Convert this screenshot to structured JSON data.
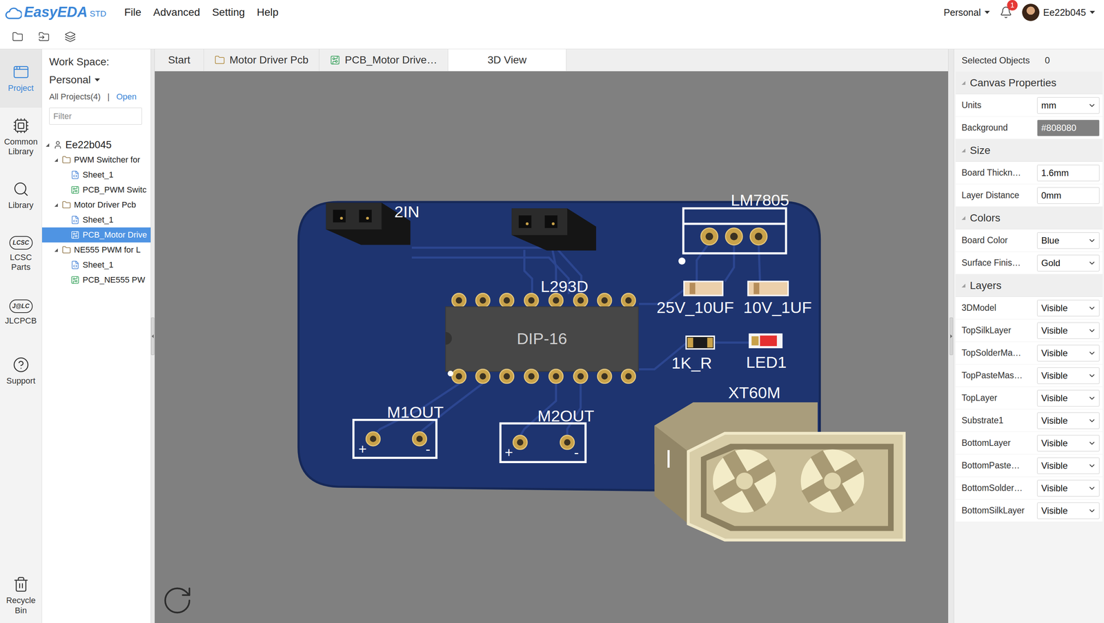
{
  "app": {
    "logo": "EasyEDA",
    "edition": "STD",
    "menu": [
      "File",
      "Advanced",
      "Setting",
      "Help"
    ],
    "workspace": "Personal",
    "notifications": "1",
    "user": "Ee22b045"
  },
  "rail": [
    {
      "label": "Project",
      "selected": true
    },
    {
      "label": "Common Library",
      "selected": false
    },
    {
      "label": "Library",
      "selected": false
    },
    {
      "label": "LCSC Parts",
      "selected": false,
      "icon_text": "LCSC"
    },
    {
      "label": "JLCPCB",
      "selected": false,
      "icon_text": "J@LC"
    },
    {
      "label": "Support",
      "selected": false
    },
    {
      "label": "Recycle Bin",
      "selected": false
    }
  ],
  "project_panel": {
    "workspace_label": "Work Space:",
    "workspace": "Personal",
    "all_projects": "All Projects(4)",
    "separator": "|",
    "open": "Open",
    "filter_placeholder": "Filter",
    "tree": {
      "label": "Ee22b045",
      "expanded": true,
      "selected": false,
      "children": [
        {
          "label": "PWM Switcher for",
          "expanded": true,
          "selected": false,
          "children": [
            {
              "label": "Sheet_1",
              "kind": "schematic",
              "selected": false
            },
            {
              "label": "PCB_PWM Switc",
              "kind": "pcb",
              "selected": false
            }
          ]
        },
        {
          "label": "Motor Driver Pcb",
          "expanded": true,
          "selected": false,
          "children": [
            {
              "label": "Sheet_1",
              "kind": "schematic",
              "selected": false
            },
            {
              "label": "PCB_Motor Drive",
              "kind": "pcb",
              "selected": true
            }
          ]
        },
        {
          "label": "NE555 PWM for L",
          "expanded": true,
          "selected": false,
          "children": [
            {
              "label": "Sheet_1",
              "kind": "schematic",
              "selected": false
            },
            {
              "label": "PCB_NE555 PW",
              "kind": "pcb",
              "selected": false
            }
          ]
        }
      ]
    }
  },
  "tabs": [
    {
      "label": "Start",
      "kind": "plain",
      "selected": false
    },
    {
      "label": "Motor Driver Pcb",
      "kind": "project",
      "selected": false
    },
    {
      "label": "PCB_Motor Drive…",
      "kind": "pcb",
      "selected": false
    },
    {
      "label": "3D View",
      "kind": "plain",
      "selected": true
    }
  ],
  "board": {
    "silk_labels": [
      "2IN",
      "LM7805",
      "L293D",
      "25V_10UF",
      "10V_1UF",
      "1K_R",
      "LED1",
      "XT60M",
      "M1OUT",
      "M2OUT"
    ],
    "chip_marking": "DIP-16",
    "polarity": [
      "+",
      "-"
    ]
  },
  "properties": {
    "selected_label": "Selected Objects",
    "selected_count": "0",
    "sections": [
      {
        "title": "Canvas Properties",
        "expanded": true,
        "rows": [
          {
            "label": "Units",
            "value": "mm",
            "kind": "select"
          },
          {
            "label": "Background",
            "value": "#808080",
            "kind": "color"
          }
        ]
      },
      {
        "title": "Size",
        "expanded": true,
        "rows": [
          {
            "label": "Board Thickn…",
            "value": "1.6mm",
            "kind": "input"
          },
          {
            "label": "Layer Distance",
            "value": "0mm",
            "kind": "input"
          }
        ]
      },
      {
        "title": "Colors",
        "expanded": true,
        "rows": [
          {
            "label": "Board Color",
            "value": "Blue",
            "kind": "select"
          },
          {
            "label": "Surface Finis…",
            "value": "Gold",
            "kind": "select"
          }
        ]
      },
      {
        "title": "Layers",
        "expanded": true,
        "rows": [
          {
            "label": "3DModel",
            "value": "Visible",
            "kind": "select"
          },
          {
            "label": "TopSilkLayer",
            "value": "Visible",
            "kind": "select"
          },
          {
            "label": "TopSolderMa…",
            "value": "Visible",
            "kind": "select"
          },
          {
            "label": "TopPasteMas…",
            "value": "Visible",
            "kind": "select"
          },
          {
            "label": "TopLayer",
            "value": "Visible",
            "kind": "select"
          },
          {
            "label": "Substrate1",
            "value": "Visible",
            "kind": "select"
          },
          {
            "label": "BottomLayer",
            "value": "Visible",
            "kind": "select"
          },
          {
            "label": "BottomPaste…",
            "value": "Visible",
            "kind": "select"
          },
          {
            "label": "BottomSolder…",
            "value": "Visible",
            "kind": "select"
          },
          {
            "label": "BottomSilkLayer",
            "value": "Visible",
            "kind": "select"
          }
        ]
      }
    ]
  }
}
